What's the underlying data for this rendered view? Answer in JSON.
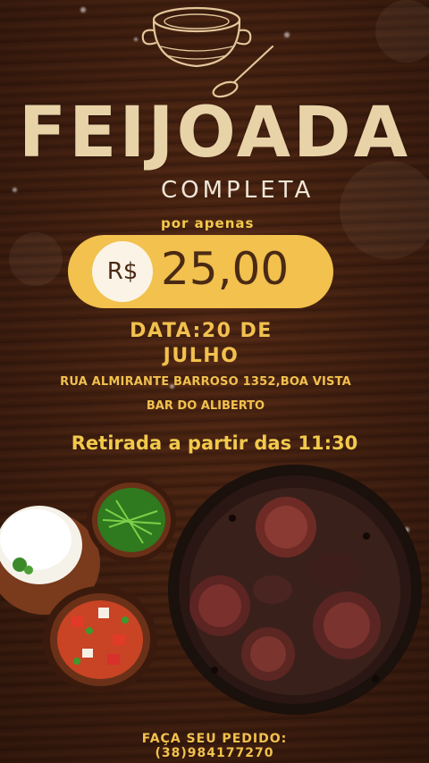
{
  "poster": {
    "title": "FEIJOADA",
    "subtitle": "COMPLETA",
    "price_prefix": "por apenas",
    "currency": "R$",
    "price": "25,00",
    "date_line1": "DATA:20 DE",
    "date_line2": "JULHO",
    "address": "RUA ALMIRANTE BARROSO 1352,BOA VISTA",
    "venue": "BAR DO ALIBERTO",
    "pickup": "Retirada a partir das 11:30",
    "order_label": "FAÇA SEU PEDIDO:",
    "phone": "(38)984177270"
  },
  "icons": [
    "soup-pot-icon",
    "spoon-icon"
  ],
  "colors": {
    "background": "#4a2413",
    "accent_gold": "#f2c14e",
    "title_cream": "#e8d3a8",
    "price_text": "#4a2a14"
  }
}
